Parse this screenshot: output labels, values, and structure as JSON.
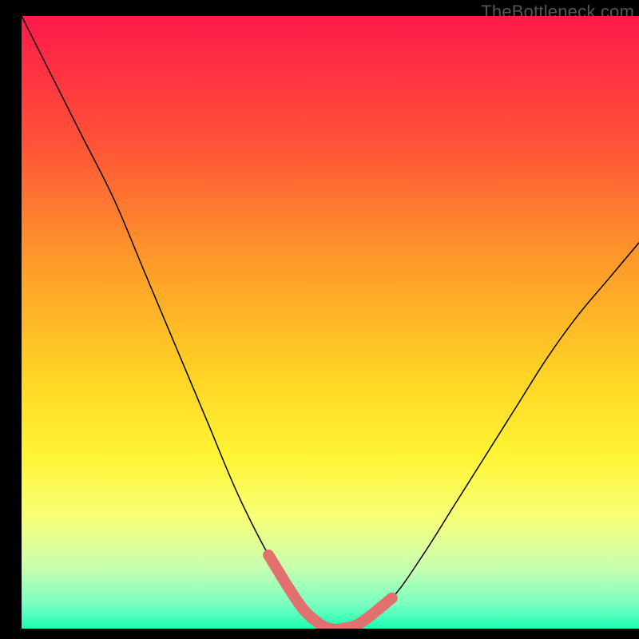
{
  "watermark": "TheBottleneck.com",
  "chart_data": {
    "type": "line",
    "title": "",
    "xlabel": "",
    "ylabel": "",
    "xlim": [
      0,
      100
    ],
    "ylim": [
      0,
      100
    ],
    "background_gradient": {
      "stops": [
        {
          "offset": 0.0,
          "color": "#ff1a4b"
        },
        {
          "offset": 0.2,
          "color": "#ff5038"
        },
        {
          "offset": 0.4,
          "color": "#ff9a2a"
        },
        {
          "offset": 0.6,
          "color": "#ffd725"
        },
        {
          "offset": 0.72,
          "color": "#fff535"
        },
        {
          "offset": 0.82,
          "color": "#f7ff7a"
        },
        {
          "offset": 0.9,
          "color": "#c8ffb0"
        },
        {
          "offset": 0.96,
          "color": "#7affc0"
        },
        {
          "offset": 1.0,
          "color": "#1affb3"
        }
      ]
    },
    "series": [
      {
        "name": "bottleneck-curve",
        "stroke": "#000000",
        "x": [
          0,
          5,
          10,
          15,
          20,
          25,
          30,
          35,
          40,
          45,
          48,
          50,
          52,
          55,
          60,
          65,
          70,
          75,
          80,
          85,
          90,
          95,
          100
        ],
        "y": [
          100,
          90,
          80,
          70,
          58,
          46,
          34,
          22,
          12,
          4,
          1,
          0,
          0,
          1,
          5,
          12,
          20,
          28,
          36,
          44,
          51,
          57,
          63
        ]
      },
      {
        "name": "optimal-band",
        "stroke": "#e2706f",
        "stroke_width": 14,
        "x": [
          40,
          45,
          48,
          50,
          52,
          55,
          60
        ],
        "y": [
          12,
          4,
          1,
          0,
          0,
          1,
          5
        ]
      }
    ],
    "annotations": []
  }
}
